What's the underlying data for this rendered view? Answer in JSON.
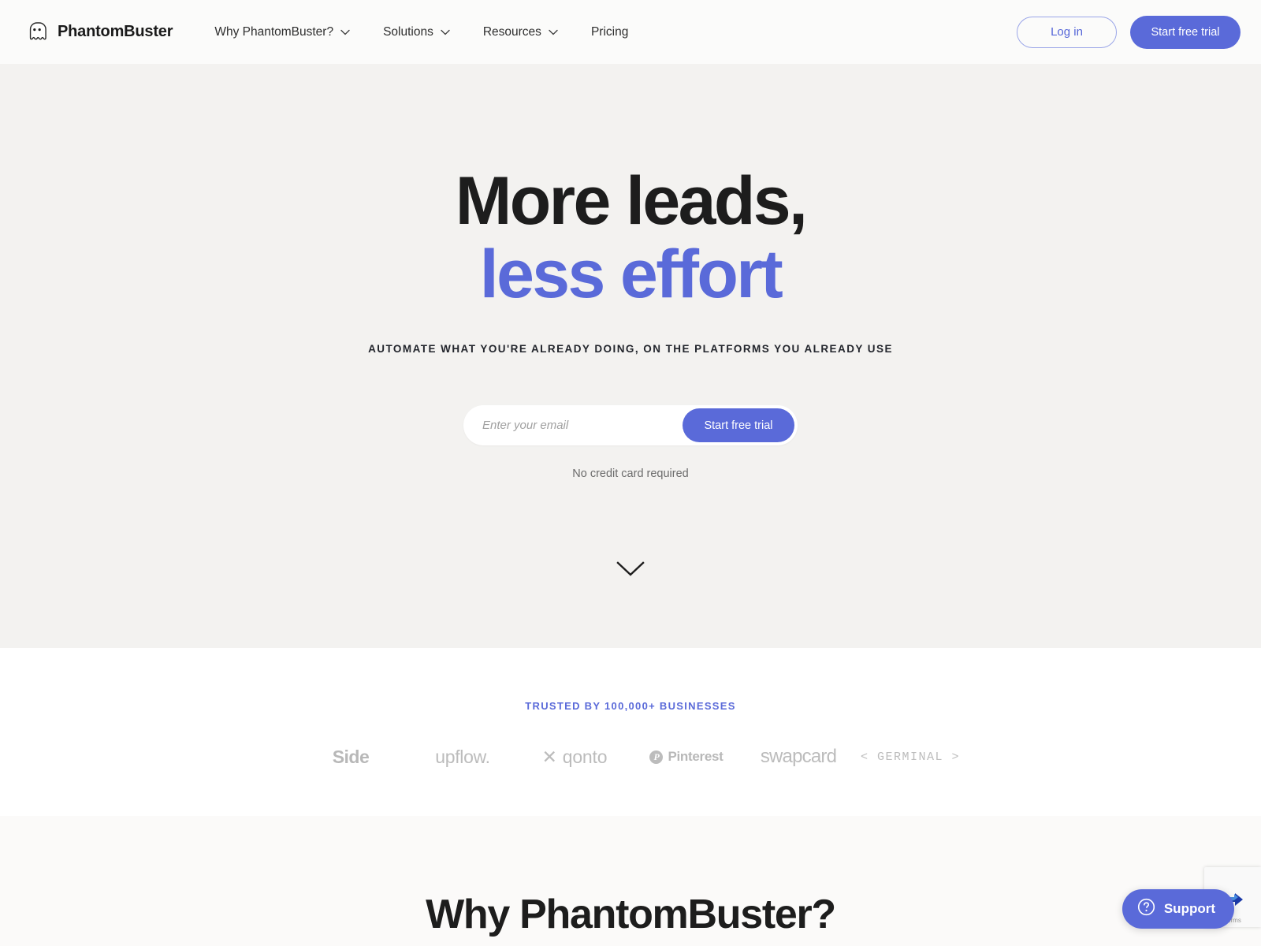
{
  "header": {
    "brand": {
      "name": "PhantomBuster",
      "icon": "ghost-icon"
    },
    "nav": [
      {
        "label": "Why PhantomBuster?",
        "has_dropdown": true
      },
      {
        "label": "Solutions",
        "has_dropdown": true
      },
      {
        "label": "Resources",
        "has_dropdown": true
      },
      {
        "label": "Pricing",
        "has_dropdown": false
      }
    ],
    "login_label": "Log in",
    "trial_label": "Start free trial"
  },
  "hero": {
    "headline_line1": "More leads,",
    "headline_line2": "less effort",
    "subhead": "AUTOMATE WHAT YOU'RE ALREADY DOING, ON THE PLATFORMS YOU ALREADY USE",
    "email_placeholder": "Enter your email",
    "email_value": "",
    "cta_label": "Start free trial",
    "note": "No credit card required",
    "scroll_icon": "chevron-down-icon",
    "accent_color": "#5a6ad9",
    "background_color": "#f3f2f0"
  },
  "trusted": {
    "label": "TRUSTED BY 100,000+ BUSINESSES",
    "label_color": "#5a6ad9",
    "logos": [
      {
        "name": "Side",
        "text": "Side"
      },
      {
        "name": "upflow",
        "text": "upflow."
      },
      {
        "name": "qonto",
        "text": "qonto",
        "mark": "✕"
      },
      {
        "name": "pinterest",
        "text": "Pinterest",
        "mark": "P"
      },
      {
        "name": "swapcard",
        "text": "swapcard"
      },
      {
        "name": "germinal",
        "text": "< GERMINAL >"
      }
    ]
  },
  "why": {
    "title": "Why PhantomBuster?"
  },
  "recaptcha": {
    "terms_label": "Terms"
  },
  "support": {
    "label": "Support",
    "icon": "question-mark-circle-icon",
    "color": "#5a6ad9"
  }
}
